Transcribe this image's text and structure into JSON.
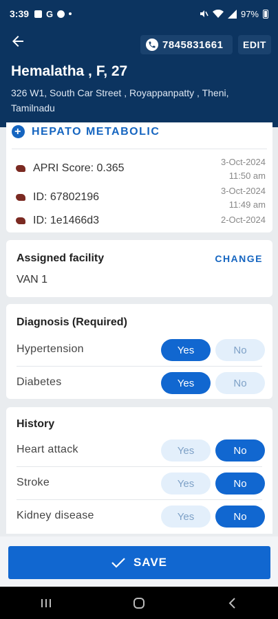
{
  "status_bar": {
    "time": "3:39",
    "battery": "97%"
  },
  "patient": {
    "phone": "7845831661",
    "edit_label": "EDIT",
    "name_line": "Hemalatha , F, 27",
    "address": "326 W1, South Car Street , Royappanpatty , Theni, Tamilnadu"
  },
  "hepato": {
    "title": "HEPATO METABOLIC",
    "records": [
      {
        "text": "APRI Score: 0.365",
        "date": "3-Oct-2024",
        "time": "11:50 am"
      },
      {
        "text": "ID: 67802196",
        "date": "3-Oct-2024",
        "time": "11:49 am"
      },
      {
        "text": "ID: 1e1466d3",
        "date": "2-Oct-2024",
        "time": ""
      }
    ]
  },
  "facility": {
    "label": "Assigned facility",
    "change_label": "CHANGE",
    "value": "VAN 1"
  },
  "diagnosis": {
    "title": "Diagnosis (Required)",
    "items": [
      {
        "label": "Hypertension",
        "yes": "Yes",
        "no": "No",
        "selected": "yes"
      },
      {
        "label": "Diabetes",
        "yes": "Yes",
        "no": "No",
        "selected": "yes"
      }
    ]
  },
  "history": {
    "title": "History",
    "items": [
      {
        "label": "Heart attack",
        "yes": "Yes",
        "no": "No",
        "selected": "no"
      },
      {
        "label": "Stroke",
        "yes": "Yes",
        "no": "No",
        "selected": "no"
      },
      {
        "label": "Kidney disease",
        "yes": "Yes",
        "no": "No",
        "selected": "no"
      }
    ]
  },
  "save_label": "SAVE",
  "colors": {
    "header": "#0c3460",
    "accent": "#1167d0",
    "link": "#1565c0"
  }
}
